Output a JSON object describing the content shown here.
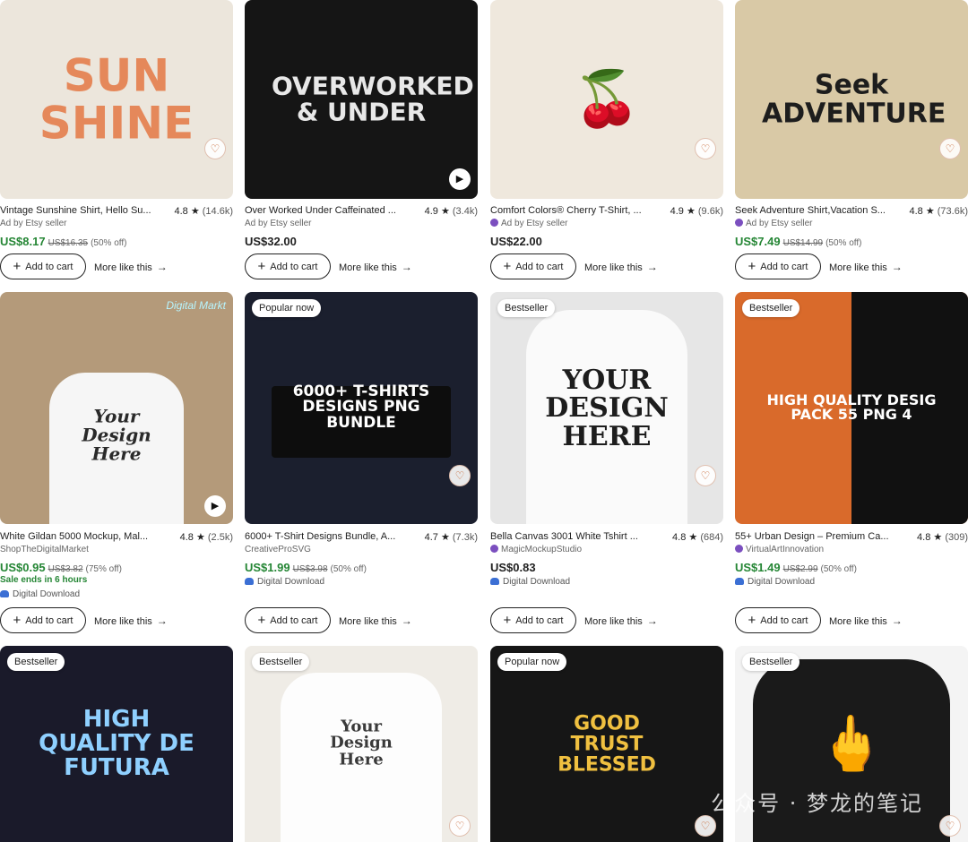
{
  "ui": {
    "add_to_cart": "Add to cart",
    "more_like_this": "More like this",
    "watermark": "公众号 · 梦龙的笔记"
  },
  "products": [
    {
      "image_text": "SUN SHINE",
      "title": "Vintage Sunshine Shirt, Hello Su...",
      "rating": "4.8",
      "count": "(14.6k)",
      "seller": "Ad by Etsy seller",
      "price": "US$8.17",
      "original_price": "US$16.35",
      "discount": "(50% off)",
      "colors": {
        "bg": "#ece6dc",
        "fg": "#e5885a"
      }
    },
    {
      "image_text": "OVERWORKED & UNDER",
      "title": "Over Worked Under Caffeinated ...",
      "rating": "4.9",
      "count": "(3.4k)",
      "seller": "Ad by Etsy seller",
      "price": "US$32.00",
      "colors": {
        "bg": "#151515",
        "fg": "#e8e8e8"
      }
    },
    {
      "image_text": "🍒",
      "title": "Comfort Colors® Cherry T-Shirt, ...",
      "rating": "4.9",
      "count": "(9.6k)",
      "seller": "Ad by Etsy seller",
      "price": "US$22.00",
      "colors": {
        "bg": "#efe8dd",
        "fg": "#b51c2c"
      }
    },
    {
      "image_text": "Seek ADVENTURE",
      "title": "Seek Adventure Shirt,Vacation S...",
      "rating": "4.8",
      "count": "(73.6k)",
      "seller": "Ad by Etsy seller",
      "price": "US$7.49",
      "original_price": "US$14.99",
      "discount": "(50% off)",
      "colors": {
        "bg": "#d9c9a6",
        "fg": "#1d1d1d"
      }
    },
    {
      "image_text": "Your Design Here",
      "badge": "Digital Markt",
      "title": "White Gildan 5000 Mockup, Mal...",
      "rating": "4.8",
      "count": "(2.5k)",
      "seller": "ShopTheDigitalMarket",
      "price": "US$0.95",
      "original_price": "US$3.82",
      "discount": "(75% off)",
      "ends": "Sale ends in 6 hours",
      "download": "Digital Download",
      "colors": {
        "bg": "#b49a7a",
        "fg": "#2a2a2a"
      }
    },
    {
      "image_text": "6000+ T-SHIRTS DESIGNS PNG BUNDLE",
      "badge": "Popular now",
      "title": "6000+ T-Shirt Designs Bundle, A...",
      "rating": "4.7",
      "count": "(7.3k)",
      "seller": "CreativeProSVG",
      "price": "US$1.99",
      "original_price": "US$3.98",
      "discount": "(50% off)",
      "download": "Digital Download",
      "colors": {
        "bg": "#1b1f2e",
        "fg": "#ffffff"
      }
    },
    {
      "image_text": "YOUR DESIGN HERE",
      "badge": "Bestseller",
      "title": "Bella Canvas 3001 White Tshirt ...",
      "rating": "4.8",
      "count": "(684)",
      "seller": "MagicMockupStudio",
      "price": "US$0.83",
      "download": "Digital Download",
      "colors": {
        "bg": "#e6e6e6",
        "fg": "#1d1d1d"
      }
    },
    {
      "image_text": "HIGH QUALITY DESIG PACK 55 PNG 4",
      "badge": "Bestseller",
      "title": "55+ Urban Design – Premium Ca...",
      "rating": "4.8",
      "count": "(309)",
      "seller": "VirtualArtInnovation",
      "price": "US$1.49",
      "original_price": "US$2.99",
      "discount": "(50% off)",
      "download": "Digital Download",
      "colors": {
        "bg": "#d96a2b",
        "fg": "#ffffff"
      }
    },
    {
      "image_text": "HIGH QUALITY DE FUTURA",
      "badge": "Bestseller",
      "colors": {
        "bg": "#1a1a2a",
        "fg": "#8fd0ff"
      }
    },
    {
      "image_text": "Your Design Here",
      "badge": "Bestseller",
      "colors": {
        "bg": "#efece6",
        "fg": "#3a3a3a"
      }
    },
    {
      "image_text": "GOOD TRUST BLESSED",
      "badge": "Popular now",
      "colors": {
        "bg": "#161616",
        "fg": "#f0c040"
      }
    },
    {
      "image_text": "🖕",
      "badge": "Bestseller",
      "colors": {
        "bg": "#f4f4f4",
        "fg": "#1a1a1a"
      }
    }
  ]
}
